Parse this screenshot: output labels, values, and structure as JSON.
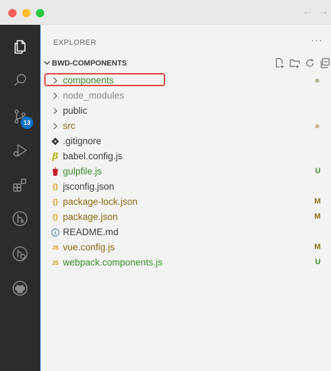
{
  "nav": {
    "back": "←",
    "forward": "→"
  },
  "activity_bar": {
    "icons": [
      "explorer-icon",
      "search-icon",
      "source-control-icon",
      "run-debug-icon",
      "extensions-icon",
      "git-graph-icon",
      "remote-explorer-icon",
      "github-icon"
    ],
    "badge": "13",
    "badge_color": "#0e72c8"
  },
  "sidebar": {
    "title": "EXPLORER",
    "more": "···",
    "section_title": "BWD-COMPONENTS",
    "section_actions": [
      "new-file-icon",
      "new-folder-icon",
      "refresh-icon",
      "collapse-all-icon"
    ]
  },
  "files": [
    {
      "name": "components",
      "type": "folder",
      "status_dot": true,
      "color": "#3a8a2a"
    },
    {
      "name": "node_modules",
      "type": "folder",
      "status_dot": false,
      "color": "#8a8a8a"
    },
    {
      "name": "public",
      "type": "folder",
      "status_dot": false,
      "color": "#3b3b3b"
    },
    {
      "name": "src",
      "type": "folder",
      "status_dot": true,
      "color": "#8a6a10"
    },
    {
      "name": ".gitignore",
      "type": "file",
      "icon": "git-icon",
      "color": "#3b3b3b",
      "status": ""
    },
    {
      "name": "babel.config.js",
      "type": "file",
      "icon": "babel-icon",
      "color": "#3b3b3b",
      "status": ""
    },
    {
      "name": "gulpfile.js",
      "type": "file",
      "icon": "gulp-icon",
      "color": "#3a8a2a",
      "status": "U"
    },
    {
      "name": "jsconfig.json",
      "type": "file",
      "icon": "json-icon",
      "color": "#3b3b3b",
      "status": ""
    },
    {
      "name": "package-lock.json",
      "type": "file",
      "icon": "json-icon",
      "color": "#8a6a10",
      "status": "M"
    },
    {
      "name": "package.json",
      "type": "file",
      "icon": "json-icon",
      "color": "#8a6a10",
      "status": "M"
    },
    {
      "name": "README.md",
      "type": "file",
      "icon": "info-icon",
      "color": "#3b3b3b",
      "status": ""
    },
    {
      "name": "vue.config.js",
      "type": "file",
      "icon": "js-icon",
      "color": "#8a6a10",
      "status": "M"
    },
    {
      "name": "webpack.components.js",
      "type": "file",
      "icon": "js-icon",
      "color": "#3a8a2a",
      "status": "U"
    }
  ],
  "colors": {
    "modified": "#8a6a10",
    "untracked": "#3a8a2a",
    "dot": "#b5b59a",
    "json_icon": "#c8a010",
    "js_icon": "#c8a010",
    "gulp_icon": "#c8202a",
    "babel_icon": "#b5b510",
    "info_icon": "#4a7fb5",
    "highlight": "#e0443e"
  }
}
